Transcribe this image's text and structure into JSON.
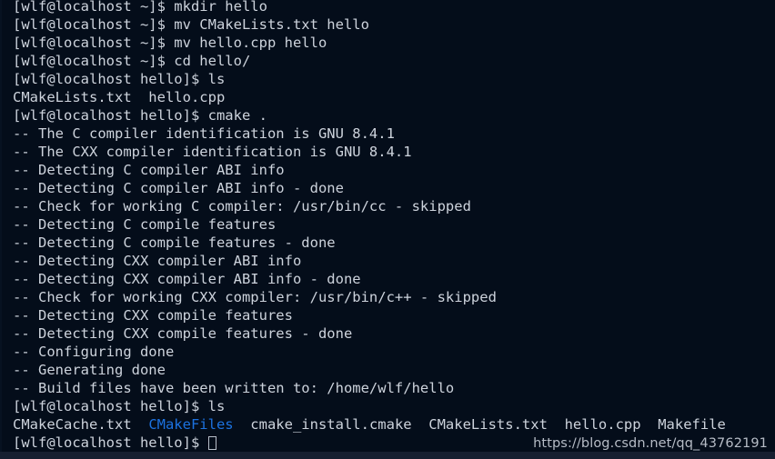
{
  "terminal": {
    "background_color": "#040d1a",
    "foreground_color": "#cdd3dc",
    "directory_color": "#1c72e0",
    "status_bar_color": "#161f30",
    "lines": [
      {
        "segments": [
          {
            "text": "[wlf@localhost ~]$ mkdir hello",
            "color": "default"
          }
        ]
      },
      {
        "segments": [
          {
            "text": "[wlf@localhost ~]$ mv CMakeLists.txt hello",
            "color": "default"
          }
        ]
      },
      {
        "segments": [
          {
            "text": "[wlf@localhost ~]$ mv hello.cpp hello",
            "color": "default"
          }
        ]
      },
      {
        "segments": [
          {
            "text": "[wlf@localhost ~]$ cd hello/",
            "color": "default"
          }
        ]
      },
      {
        "segments": [
          {
            "text": "[wlf@localhost hello]$ ls",
            "color": "default"
          }
        ]
      },
      {
        "segments": [
          {
            "text": "CMakeLists.txt  hello.cpp",
            "color": "default"
          }
        ]
      },
      {
        "segments": [
          {
            "text": "[wlf@localhost hello]$ cmake .",
            "color": "default"
          }
        ]
      },
      {
        "segments": [
          {
            "text": "-- The C compiler identification is GNU 8.4.1",
            "color": "default"
          }
        ]
      },
      {
        "segments": [
          {
            "text": "-- The CXX compiler identification is GNU 8.4.1",
            "color": "default"
          }
        ]
      },
      {
        "segments": [
          {
            "text": "-- Detecting C compiler ABI info",
            "color": "default"
          }
        ]
      },
      {
        "segments": [
          {
            "text": "-- Detecting C compiler ABI info - done",
            "color": "default"
          }
        ]
      },
      {
        "segments": [
          {
            "text": "-- Check for working C compiler: /usr/bin/cc - skipped",
            "color": "default"
          }
        ]
      },
      {
        "segments": [
          {
            "text": "-- Detecting C compile features",
            "color": "default"
          }
        ]
      },
      {
        "segments": [
          {
            "text": "-- Detecting C compile features - done",
            "color": "default"
          }
        ]
      },
      {
        "segments": [
          {
            "text": "-- Detecting CXX compiler ABI info",
            "color": "default"
          }
        ]
      },
      {
        "segments": [
          {
            "text": "-- Detecting CXX compiler ABI info - done",
            "color": "default"
          }
        ]
      },
      {
        "segments": [
          {
            "text": "-- Check for working CXX compiler: /usr/bin/c++ - skipped",
            "color": "default"
          }
        ]
      },
      {
        "segments": [
          {
            "text": "-- Detecting CXX compile features",
            "color": "default"
          }
        ]
      },
      {
        "segments": [
          {
            "text": "-- Detecting CXX compile features - done",
            "color": "default"
          }
        ]
      },
      {
        "segments": [
          {
            "text": "-- Configuring done",
            "color": "default"
          }
        ]
      },
      {
        "segments": [
          {
            "text": "-- Generating done",
            "color": "default"
          }
        ]
      },
      {
        "segments": [
          {
            "text": "-- Build files have been written to: /home/wlf/hello",
            "color": "default"
          }
        ]
      },
      {
        "segments": [
          {
            "text": "[wlf@localhost hello]$ ls",
            "color": "default"
          }
        ]
      },
      {
        "segments": [
          {
            "text": "CMakeCache.txt  ",
            "color": "default"
          },
          {
            "text": "CMakeFiles",
            "color": "dir"
          },
          {
            "text": "  cmake_install.cmake  CMakeLists.txt  hello.cpp  Makefile",
            "color": "default"
          }
        ]
      },
      {
        "segments": [
          {
            "text": "[wlf@localhost hello]$ ",
            "color": "default"
          }
        ],
        "cursor": true
      }
    ]
  },
  "watermark": {
    "text": "https://blog.csdn.net/qq_43762191"
  }
}
